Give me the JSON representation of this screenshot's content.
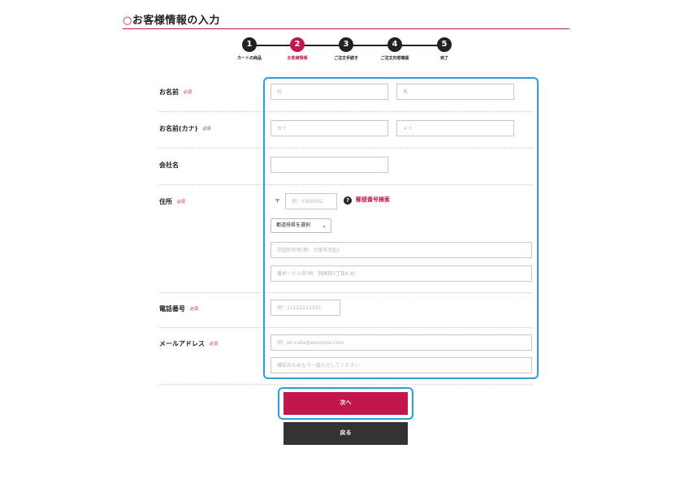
{
  "page": {
    "title_mark": "○",
    "title": "お客様情報の入力"
  },
  "steps": [
    {
      "num": "1",
      "label": "カートの商品"
    },
    {
      "num": "2",
      "label": "お客様情報"
    },
    {
      "num": "3",
      "label": "ご注文手続き"
    },
    {
      "num": "4",
      "label": "ご注文内容確認"
    },
    {
      "num": "5",
      "label": "完了"
    }
  ],
  "active_step": 2,
  "form": {
    "required_label": "必須",
    "name": {
      "label": "お名前",
      "last_placeholder": "姓",
      "first_placeholder": "名"
    },
    "kana": {
      "label": "お名前(カナ)",
      "last_placeholder": "セイ",
      "first_placeholder": "メイ"
    },
    "company": {
      "label": "会社名",
      "placeholder": ""
    },
    "address": {
      "label": "住所",
      "zip_mark": "〒",
      "zip_placeholder": "例：5300001",
      "zip_search_link": "郵便番号検索",
      "pref_selected": "都道府県を選択",
      "city_placeholder": "市区町村名(例：大阪市北区)",
      "street_placeholder": "番地・ビル名(例：西梅田1丁目6-8)"
    },
    "phone": {
      "label": "電話番号",
      "placeholder": "例：11122223333"
    },
    "email": {
      "label": "メールアドレス",
      "placeholder": "例：ec-cube@example.com",
      "confirm_placeholder": "確認のためもう一度入力してください"
    }
  },
  "buttons": {
    "next": "次へ",
    "back": "戻る"
  },
  "colors": {
    "accent": "#c1174a",
    "focus": "#2a9fd8",
    "dark": "#333333"
  }
}
